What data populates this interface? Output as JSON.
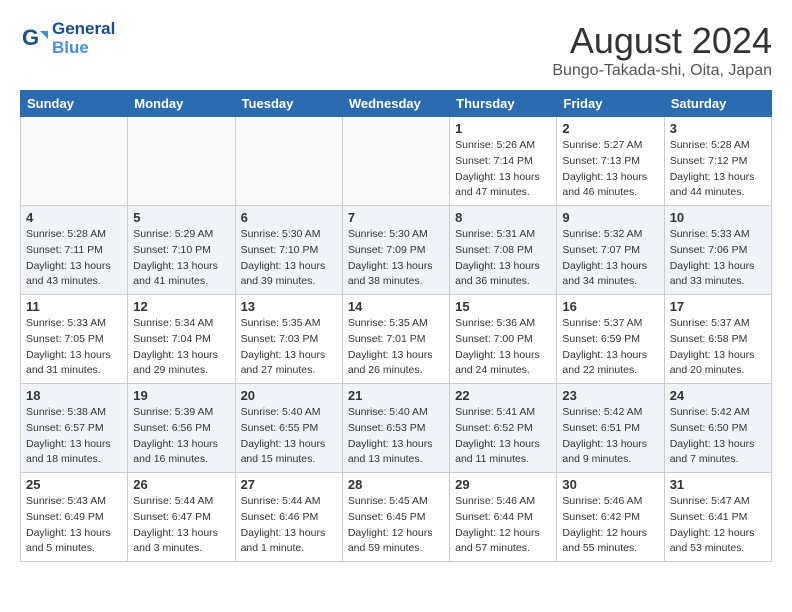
{
  "header": {
    "logo_line1": "General",
    "logo_line2": "Blue",
    "title": "August 2024",
    "subtitle": "Bungo-Takada-shi, Oita, Japan"
  },
  "days_of_week": [
    "Sunday",
    "Monday",
    "Tuesday",
    "Wednesday",
    "Thursday",
    "Friday",
    "Saturday"
  ],
  "weeks": [
    [
      {
        "day": "",
        "empty": true
      },
      {
        "day": "",
        "empty": true
      },
      {
        "day": "",
        "empty": true
      },
      {
        "day": "",
        "empty": true
      },
      {
        "day": "1",
        "sunrise": "5:26 AM",
        "sunset": "7:14 PM",
        "daylight": "13 hours and 47 minutes."
      },
      {
        "day": "2",
        "sunrise": "5:27 AM",
        "sunset": "7:13 PM",
        "daylight": "13 hours and 46 minutes."
      },
      {
        "day": "3",
        "sunrise": "5:28 AM",
        "sunset": "7:12 PM",
        "daylight": "13 hours and 44 minutes."
      }
    ],
    [
      {
        "day": "4",
        "sunrise": "5:28 AM",
        "sunset": "7:11 PM",
        "daylight": "13 hours and 43 minutes."
      },
      {
        "day": "5",
        "sunrise": "5:29 AM",
        "sunset": "7:10 PM",
        "daylight": "13 hours and 41 minutes."
      },
      {
        "day": "6",
        "sunrise": "5:30 AM",
        "sunset": "7:10 PM",
        "daylight": "13 hours and 39 minutes."
      },
      {
        "day": "7",
        "sunrise": "5:30 AM",
        "sunset": "7:09 PM",
        "daylight": "13 hours and 38 minutes."
      },
      {
        "day": "8",
        "sunrise": "5:31 AM",
        "sunset": "7:08 PM",
        "daylight": "13 hours and 36 minutes."
      },
      {
        "day": "9",
        "sunrise": "5:32 AM",
        "sunset": "7:07 PM",
        "daylight": "13 hours and 34 minutes."
      },
      {
        "day": "10",
        "sunrise": "5:33 AM",
        "sunset": "7:06 PM",
        "daylight": "13 hours and 33 minutes."
      }
    ],
    [
      {
        "day": "11",
        "sunrise": "5:33 AM",
        "sunset": "7:05 PM",
        "daylight": "13 hours and 31 minutes."
      },
      {
        "day": "12",
        "sunrise": "5:34 AM",
        "sunset": "7:04 PM",
        "daylight": "13 hours and 29 minutes."
      },
      {
        "day": "13",
        "sunrise": "5:35 AM",
        "sunset": "7:03 PM",
        "daylight": "13 hours and 27 minutes."
      },
      {
        "day": "14",
        "sunrise": "5:35 AM",
        "sunset": "7:01 PM",
        "daylight": "13 hours and 26 minutes."
      },
      {
        "day": "15",
        "sunrise": "5:36 AM",
        "sunset": "7:00 PM",
        "daylight": "13 hours and 24 minutes."
      },
      {
        "day": "16",
        "sunrise": "5:37 AM",
        "sunset": "6:59 PM",
        "daylight": "13 hours and 22 minutes."
      },
      {
        "day": "17",
        "sunrise": "5:37 AM",
        "sunset": "6:58 PM",
        "daylight": "13 hours and 20 minutes."
      }
    ],
    [
      {
        "day": "18",
        "sunrise": "5:38 AM",
        "sunset": "6:57 PM",
        "daylight": "13 hours and 18 minutes."
      },
      {
        "day": "19",
        "sunrise": "5:39 AM",
        "sunset": "6:56 PM",
        "daylight": "13 hours and 16 minutes."
      },
      {
        "day": "20",
        "sunrise": "5:40 AM",
        "sunset": "6:55 PM",
        "daylight": "13 hours and 15 minutes."
      },
      {
        "day": "21",
        "sunrise": "5:40 AM",
        "sunset": "6:53 PM",
        "daylight": "13 hours and 13 minutes."
      },
      {
        "day": "22",
        "sunrise": "5:41 AM",
        "sunset": "6:52 PM",
        "daylight": "13 hours and 11 minutes."
      },
      {
        "day": "23",
        "sunrise": "5:42 AM",
        "sunset": "6:51 PM",
        "daylight": "13 hours and 9 minutes."
      },
      {
        "day": "24",
        "sunrise": "5:42 AM",
        "sunset": "6:50 PM",
        "daylight": "13 hours and 7 minutes."
      }
    ],
    [
      {
        "day": "25",
        "sunrise": "5:43 AM",
        "sunset": "6:49 PM",
        "daylight": "13 hours and 5 minutes."
      },
      {
        "day": "26",
        "sunrise": "5:44 AM",
        "sunset": "6:47 PM",
        "daylight": "13 hours and 3 minutes."
      },
      {
        "day": "27",
        "sunrise": "5:44 AM",
        "sunset": "6:46 PM",
        "daylight": "13 hours and 1 minute."
      },
      {
        "day": "28",
        "sunrise": "5:45 AM",
        "sunset": "6:45 PM",
        "daylight": "12 hours and 59 minutes."
      },
      {
        "day": "29",
        "sunrise": "5:46 AM",
        "sunset": "6:44 PM",
        "daylight": "12 hours and 57 minutes."
      },
      {
        "day": "30",
        "sunrise": "5:46 AM",
        "sunset": "6:42 PM",
        "daylight": "12 hours and 55 minutes."
      },
      {
        "day": "31",
        "sunrise": "5:47 AM",
        "sunset": "6:41 PM",
        "daylight": "12 hours and 53 minutes."
      }
    ]
  ]
}
